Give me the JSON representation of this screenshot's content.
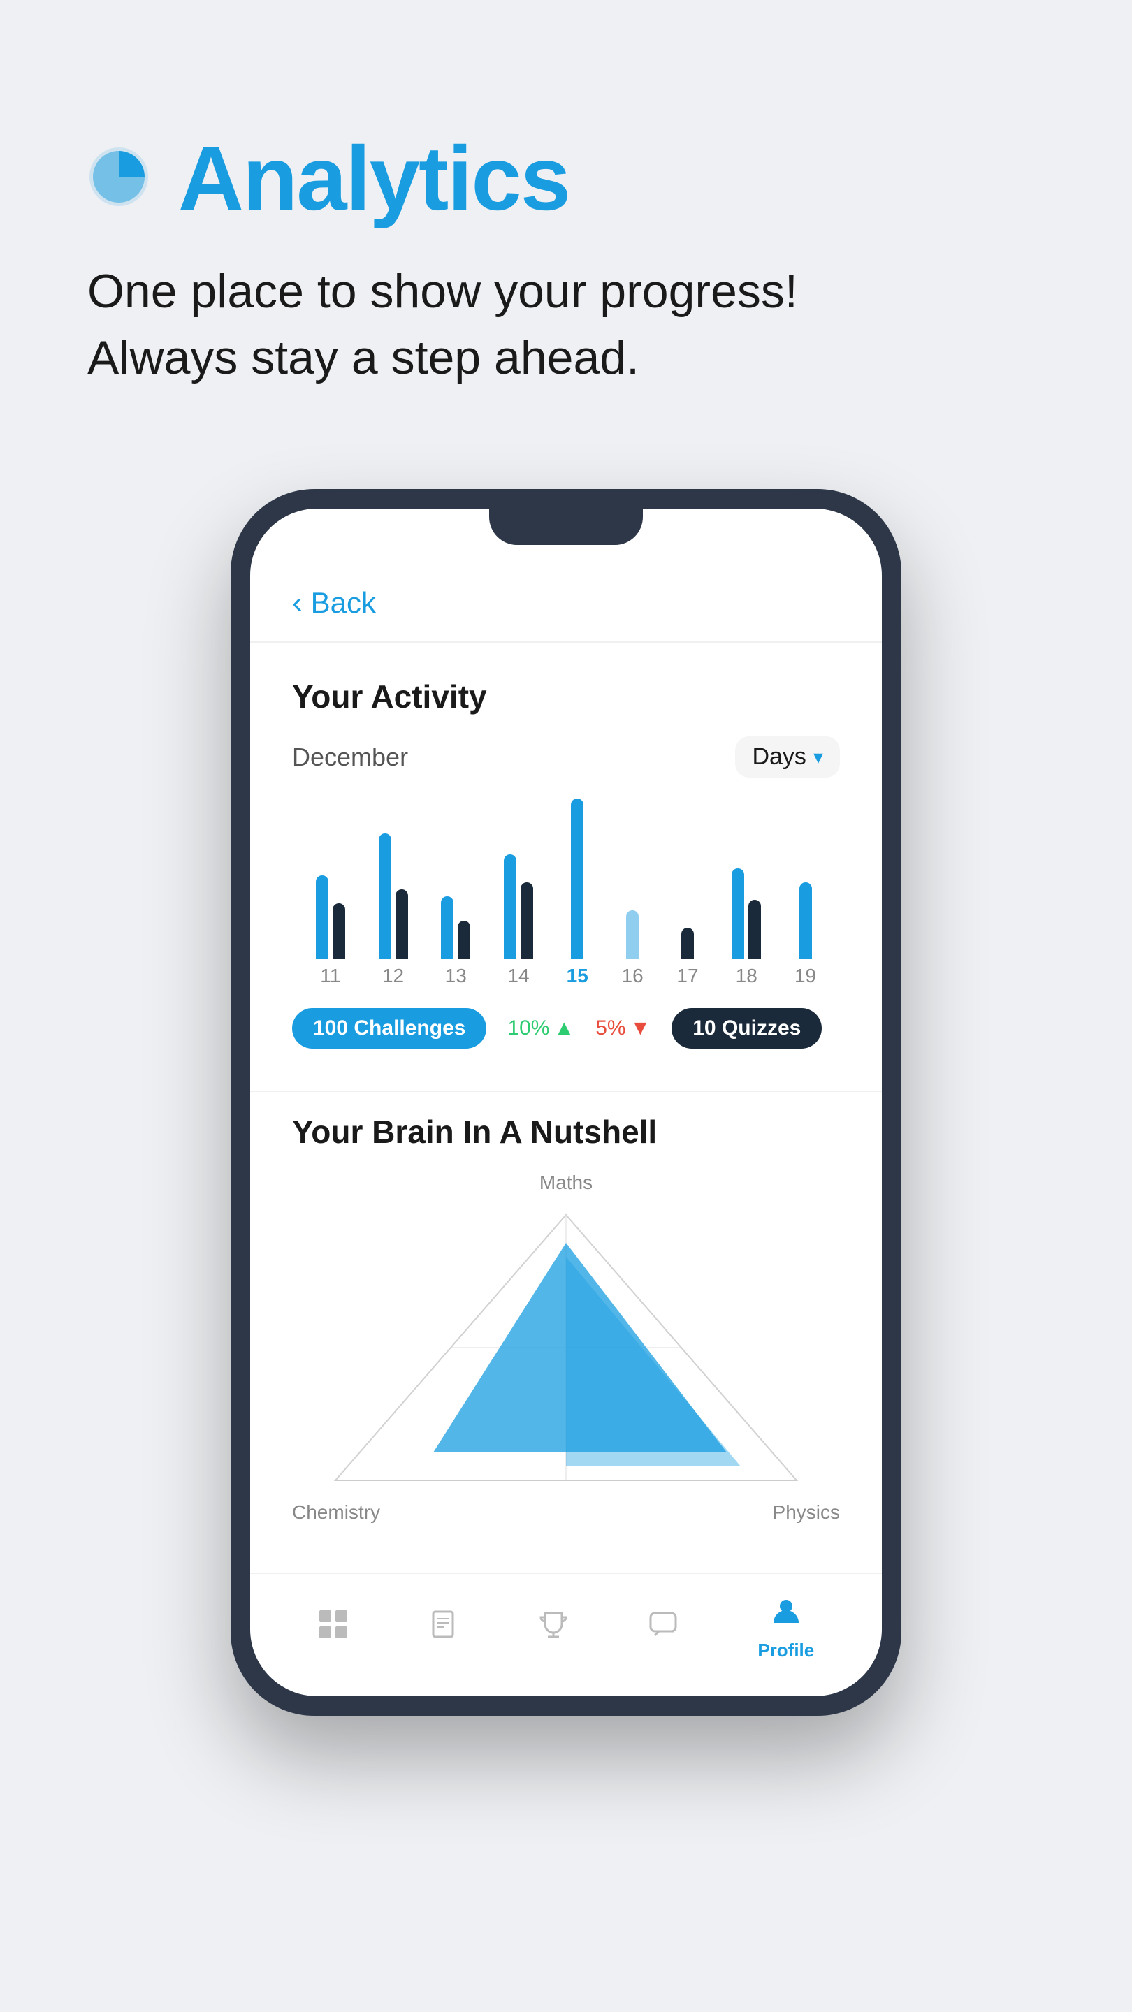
{
  "header": {
    "title": "Analytics",
    "subtitle_line1": "One place to show your progress!",
    "subtitle_line2": "Always stay a step ahead.",
    "icon": "pie-chart"
  },
  "phone": {
    "back_label": "Back",
    "activity": {
      "title": "Your Activity",
      "month": "December",
      "period": "Days",
      "bars": [
        {
          "day": "11",
          "h1": 120,
          "h2": 80,
          "active": false
        },
        {
          "day": "12",
          "h1": 180,
          "h2": 100,
          "active": false
        },
        {
          "day": "13",
          "h1": 90,
          "h2": 60,
          "active": false
        },
        {
          "day": "14",
          "h1": 150,
          "h2": 110,
          "active": false
        },
        {
          "day": "15",
          "h1": 220,
          "h2": 0,
          "active": true
        },
        {
          "day": "16",
          "h1": 70,
          "h2": 0,
          "active": false
        },
        {
          "day": "17",
          "h1": 50,
          "h2": 0,
          "active": false
        },
        {
          "day": "18",
          "h1": 130,
          "h2": 90,
          "active": false
        },
        {
          "day": "19",
          "h1": 110,
          "h2": 0,
          "active": false
        }
      ],
      "challenges_label": "100 Challenges",
      "pct1_label": "10%",
      "pct1_dir": "up",
      "pct2_label": "5%",
      "pct2_dir": "down",
      "quizzes_label": "10 Quizzes"
    },
    "brain": {
      "title": "Your Brain In A Nutshell",
      "labels": {
        "top": "Maths",
        "bottom_left": "Chemistry",
        "bottom_right": "Physics"
      }
    },
    "nav": {
      "items": [
        {
          "icon": "grid",
          "label": "",
          "active": false
        },
        {
          "icon": "book",
          "label": "",
          "active": false
        },
        {
          "icon": "trophy",
          "label": "",
          "active": false
        },
        {
          "icon": "chat",
          "label": "",
          "active": false
        },
        {
          "icon": "profile",
          "label": "Profile",
          "active": true
        }
      ]
    }
  }
}
